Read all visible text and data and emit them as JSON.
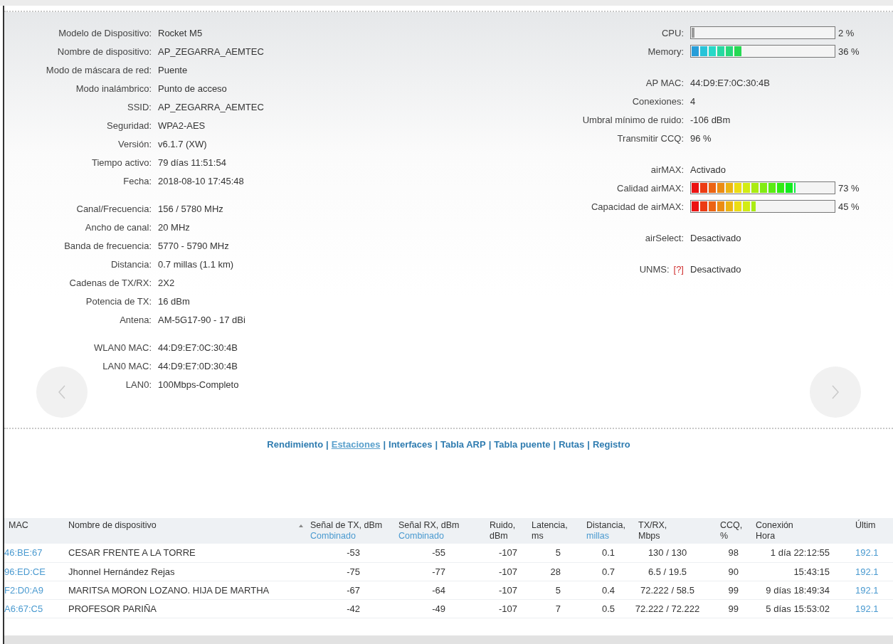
{
  "device_info": {
    "left_groups": [
      [
        {
          "label": "Modelo de Dispositivo:",
          "value": "Rocket M5"
        },
        {
          "label": "Nombre de dispositivo:",
          "value": "AP_ZEGARRA_AEMTEC"
        },
        {
          "label": "Modo de máscara de red:",
          "value": "Puente"
        },
        {
          "label": "Modo inalámbrico:",
          "value": "Punto de acceso"
        },
        {
          "label": "SSID:",
          "value": "AP_ZEGARRA_AEMTEC"
        },
        {
          "label": "Seguridad:",
          "value": "WPA2-AES"
        },
        {
          "label": "Versión:",
          "value": "v6.1.7 (XW)"
        },
        {
          "label": "Tiempo activo:",
          "value": "79 días 11:51:54"
        },
        {
          "label": "Fecha:",
          "value": "2018-08-10 17:45:48"
        }
      ],
      [
        {
          "label": "Canal/Frecuencia:",
          "value": "156 / 5780 MHz"
        },
        {
          "label": "Ancho de canal:",
          "value": "20 MHz"
        },
        {
          "label": "Banda de frecuencia:",
          "value": "5770 - 5790 MHz"
        },
        {
          "label": "Distancia:",
          "value": "0.7 millas (1.1 km)"
        },
        {
          "label": "Cadenas de TX/RX:",
          "value": "2X2"
        },
        {
          "label": "Potencia de TX:",
          "value": "16 dBm"
        },
        {
          "label": "Antena:",
          "value": "AM-5G17-90 - 17 dBi"
        }
      ],
      [
        {
          "label": "WLAN0 MAC:",
          "value": "44:D9:E7:0C:30:4B"
        },
        {
          "label": "LAN0 MAC:",
          "value": "44:D9:E7:0D:30:4B"
        },
        {
          "label": "LAN0:",
          "value": "100Mbps-Completo"
        }
      ]
    ],
    "right_groups": [
      [
        {
          "kind": "cpu",
          "label": "CPU:",
          "level": 0.02,
          "reading": "2 %"
        },
        {
          "kind": "memory",
          "label": "Memory:",
          "level": 0.36,
          "reading": "36 %"
        }
      ],
      [
        {
          "kind": "text",
          "label": "AP MAC:",
          "value": "44:D9:E7:0C:30:4B"
        },
        {
          "kind": "text",
          "label": "Conexiones:",
          "value": "4"
        },
        {
          "kind": "text",
          "label": "Umbral mínimo de ruido:",
          "value": "-106 dBm"
        },
        {
          "kind": "text",
          "label": "Transmitir CCQ:",
          "value": "96 %"
        }
      ],
      [
        {
          "kind": "text",
          "label": "airMAX:",
          "value": "Activado"
        },
        {
          "kind": "airmax",
          "label": "Calidad airMAX:",
          "level": 0.73,
          "reading": "73 %"
        },
        {
          "kind": "airmax",
          "label": "Capacidad de airMAX:",
          "level": 0.45,
          "reading": "45 %"
        }
      ],
      [
        {
          "kind": "text",
          "label": "airSelect:",
          "value": "Desactivado"
        }
      ],
      [
        {
          "kind": "text",
          "label": "UNMS:",
          "help": "[?]",
          "value": "Desactivado"
        }
      ]
    ]
  },
  "tabs": [
    {
      "label": "Rendimiento",
      "selected": false,
      "separator": "|"
    },
    {
      "label": "Estaciones",
      "selected": true,
      "separator": "|"
    },
    {
      "label": "Interfaces",
      "selected": false,
      "separator": "|"
    },
    {
      "label": "Tabla ARP",
      "selected": false,
      "separator": "|"
    },
    {
      "label": "Tabla puente",
      "selected": false,
      "separator": "|"
    },
    {
      "label": "Rutas",
      "selected": false,
      "separator": "|"
    },
    {
      "label": "Registro",
      "selected": false
    }
  ],
  "stations": {
    "columns": [
      {
        "title": "MAC",
        "kind": "link"
      },
      {
        "title": "Nombre de dispositivo",
        "kind": "text",
        "sorted": true
      },
      {
        "title": "Señal de TX, dBm",
        "subtitle": "Combinado",
        "subtitle_link": true,
        "kind": "number"
      },
      {
        "title": "Señal RX, dBm",
        "subtitle": "Combinado",
        "subtitle_link": true,
        "kind": "number"
      },
      {
        "title": "Ruido,",
        "subtitle": "dBm",
        "subtitle_link": false,
        "kind": "number"
      },
      {
        "title": "Latencia,",
        "subtitle": "ms",
        "subtitle_link": false,
        "kind": "number"
      },
      {
        "title": "Distancia,",
        "subtitle": "millas",
        "subtitle_link": true,
        "kind": "number"
      },
      {
        "title": "TX/RX,",
        "subtitle": "Mbps",
        "subtitle_link": false,
        "kind": "number"
      },
      {
        "title": "CCQ,",
        "subtitle": "%",
        "subtitle_link": false,
        "kind": "number"
      },
      {
        "title": "Conexión",
        "subtitle": "Hora",
        "subtitle_link": false,
        "kind": "number"
      },
      {
        "title": "Últim",
        "kind": "link"
      }
    ],
    "rows": [
      [
        "46:BE:67",
        "CESAR FRENTE A LA TORRE",
        "-53",
        "-55",
        "-107",
        "5",
        "0.1",
        "130 / 130",
        "98",
        "1 día 22:12:55",
        "192.1"
      ],
      [
        "96:ED:CE",
        "Jhonnel Hernández Rejas",
        "-75",
        "-77",
        "-107",
        "28",
        "0.7",
        "6.5 / 19.5",
        "90",
        "15:43:15",
        "192.1"
      ],
      [
        "F2:D0:A9",
        "MARITSA MORON LOZANO. HIJA DE MARTHA",
        "-67",
        "-64",
        "-107",
        "5",
        "0.4",
        "72.222 / 58.5",
        "99",
        "9 días 18:49:34",
        "192.1"
      ],
      [
        "A6:67:C5",
        "PROFESOR PARIÑA",
        "-42",
        "-49",
        "-107",
        "7",
        "0.5",
        "72.222 / 72.222",
        "99",
        "5 días 15:53:02",
        "192.1"
      ]
    ]
  }
}
